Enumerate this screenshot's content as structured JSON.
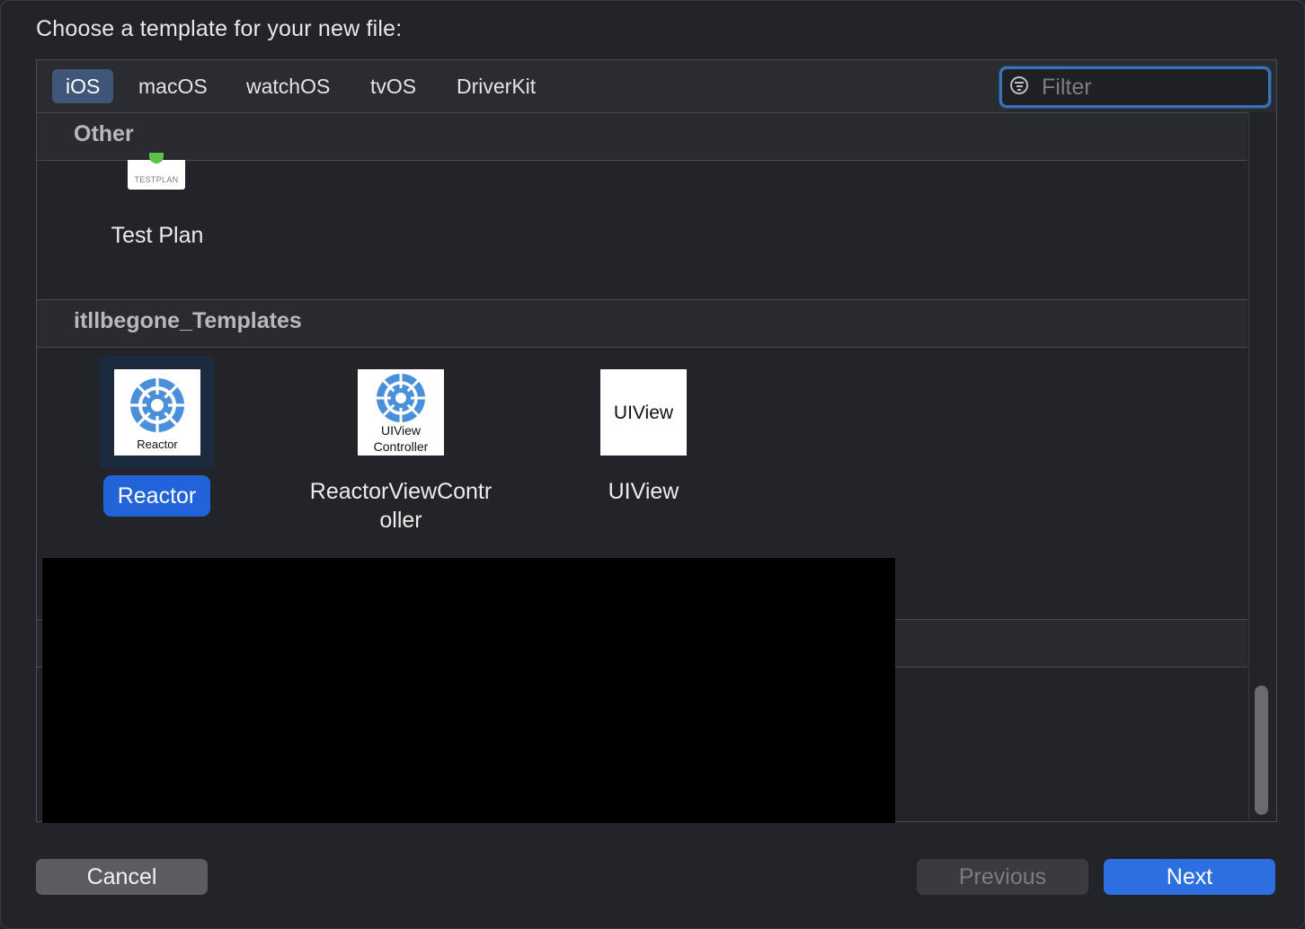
{
  "dialog": {
    "title": "Choose a template for your new file:"
  },
  "tabs": [
    {
      "label": "iOS",
      "selected": true
    },
    {
      "label": "macOS",
      "selected": false
    },
    {
      "label": "watchOS",
      "selected": false
    },
    {
      "label": "tvOS",
      "selected": false
    },
    {
      "label": "DriverKit",
      "selected": false
    }
  ],
  "filter": {
    "placeholder": "Filter",
    "value": ""
  },
  "sections": [
    {
      "title": "Other",
      "templates": [
        {
          "name": "Test Plan",
          "icon_text": "TESTPLAN",
          "icon": "testplan-icon",
          "selected": false
        }
      ]
    },
    {
      "title": "itllbegone_Templates",
      "templates": [
        {
          "name": "Reactor",
          "icon_text": "Reactor",
          "icon": "reactor-icon",
          "selected": true
        },
        {
          "name": "ReactorViewController",
          "name_line1": "ReactorViewContr",
          "name_line2": "oller",
          "icon_text_line1": "UIView",
          "icon_text_line2": "Controller",
          "icon": "reactor-view-controller-icon",
          "selected": false
        },
        {
          "name": "UIView",
          "icon_text": "UIView",
          "icon": "uiview-icon",
          "selected": false
        }
      ]
    }
  ],
  "buttons": {
    "cancel": "Cancel",
    "previous": "Previous",
    "next": "Next"
  },
  "colors": {
    "background": "#232428",
    "accent": "#2c6fe0",
    "selected_tab": "#3f5678",
    "reactor_gear": "#4a8fd9"
  }
}
